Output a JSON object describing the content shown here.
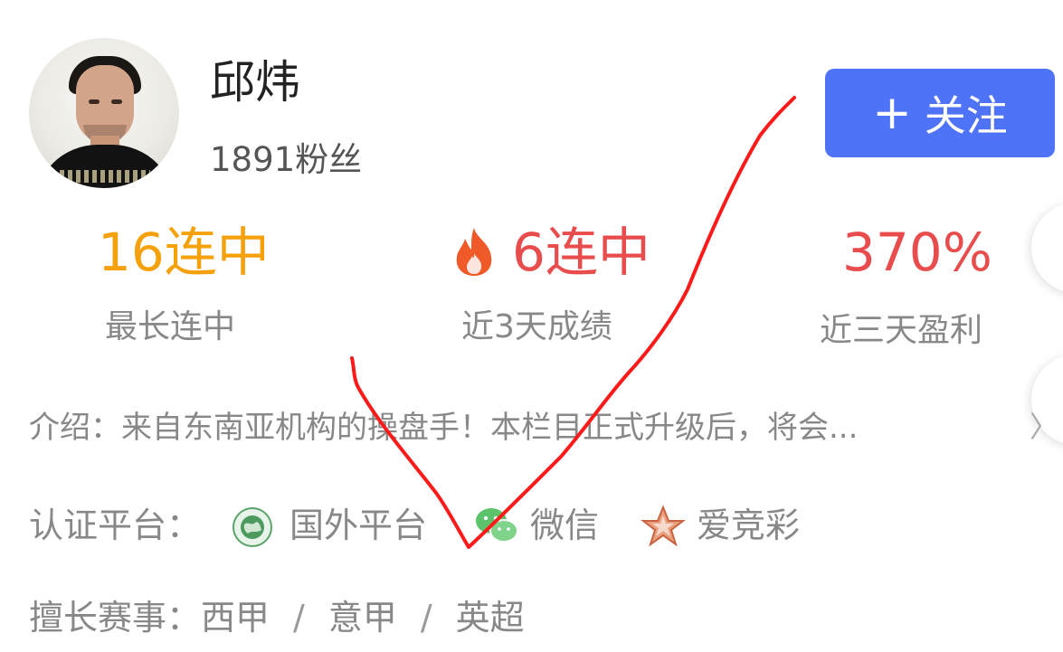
{
  "profile": {
    "name": "邱炜",
    "fans": "1891粉丝",
    "follow_label": "关注"
  },
  "stats": [
    {
      "value": "16连中",
      "label": "最长连中",
      "color": "#f5a10c"
    },
    {
      "value": "6连中",
      "label": "近3天成绩",
      "color": "#e84c4c",
      "icon": "flame-icon"
    },
    {
      "value": "370%",
      "label": "近三天盈利",
      "color": "#e84c4c"
    }
  ],
  "intro": {
    "text": "介绍：来自东南亚机构的操盘手！本栏目正式升级后，将会..."
  },
  "certification": {
    "label": "认证平台：",
    "platforms": [
      "国外平台",
      "微信",
      "爱竞彩"
    ]
  },
  "leagues": {
    "label": "擅长赛事：",
    "items": [
      "西甲",
      "意甲",
      "英超"
    ],
    "separator": "/"
  },
  "colors": {
    "accent": "#4f73f7",
    "streak_orange": "#f5a10c",
    "profit_red": "#e84c4c",
    "annotation_red": "#ff1a1a"
  }
}
